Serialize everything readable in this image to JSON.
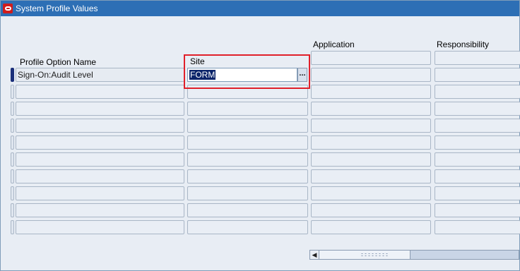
{
  "window": {
    "title": "System Profile Values",
    "icon": "oracle-logo-icon"
  },
  "columns": {
    "profile_option_name": "Profile Option Name",
    "site": "Site",
    "application": "Application",
    "responsibility": "Responsibility"
  },
  "rows": [
    {
      "name": "Sign-On:Audit Level",
      "site": "FORM"
    },
    {
      "name": "",
      "site": ""
    },
    {
      "name": "",
      "site": ""
    },
    {
      "name": "",
      "site": ""
    },
    {
      "name": "",
      "site": ""
    },
    {
      "name": "",
      "site": ""
    },
    {
      "name": "",
      "site": ""
    },
    {
      "name": "",
      "site": ""
    },
    {
      "name": "",
      "site": ""
    },
    {
      "name": "",
      "site": ""
    }
  ],
  "lov_button_label": "...",
  "colors": {
    "titlebar": "#2d6fb5",
    "highlight": "#e0202a",
    "selection": "#0a246a",
    "current_record": "#1a2f7a"
  }
}
